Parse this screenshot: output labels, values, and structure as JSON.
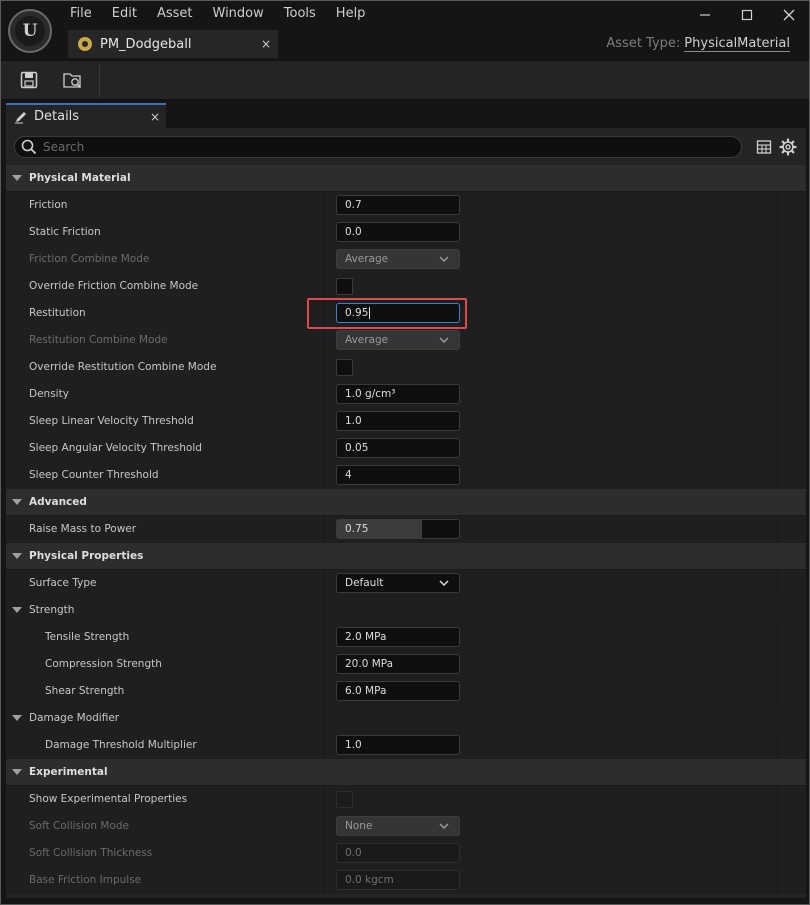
{
  "app": {
    "logo_text": "U"
  },
  "menu": [
    "File",
    "Edit",
    "Asset",
    "Window",
    "Tools",
    "Help"
  ],
  "document_tab": {
    "label": "PM_Dodgeball",
    "close": "×"
  },
  "asset_type": {
    "label": "Asset Type:",
    "value": "PhysicalMaterial"
  },
  "panel_tab": {
    "label": "Details",
    "close": "×"
  },
  "search": {
    "placeholder": "Search"
  },
  "categories": {
    "physical_material": "Physical Material",
    "advanced": "Advanced",
    "physical_properties": "Physical Properties",
    "experimental": "Experimental"
  },
  "subcategories": {
    "strength": "Strength",
    "damage_modifier": "Damage Modifier"
  },
  "props": {
    "friction": {
      "label": "Friction",
      "value": "0.7"
    },
    "static_friction": {
      "label": "Static Friction",
      "value": "0.0"
    },
    "friction_combine_mode": {
      "label": "Friction Combine Mode",
      "value": "Average"
    },
    "override_friction_combine_mode": {
      "label": "Override Friction Combine Mode",
      "checked": false
    },
    "restitution": {
      "label": "Restitution",
      "value": "0.95"
    },
    "restitution_combine_mode": {
      "label": "Restitution Combine Mode",
      "value": "Average"
    },
    "override_restitution_combine_mode": {
      "label": "Override Restitution Combine Mode",
      "checked": false
    },
    "density": {
      "label": "Density",
      "value": "1.0 g/cm³"
    },
    "sleep_linear_velocity_threshold": {
      "label": "Sleep Linear Velocity Threshold",
      "value": "1.0"
    },
    "sleep_angular_velocity_threshold": {
      "label": "Sleep Angular Velocity Threshold",
      "value": "0.05"
    },
    "sleep_counter_threshold": {
      "label": "Sleep Counter Threshold",
      "value": "4"
    },
    "raise_mass_to_power": {
      "label": "Raise Mass to Power",
      "value": "0.75",
      "fill_fraction": 0.7
    },
    "surface_type": {
      "label": "Surface Type",
      "value": "Default"
    },
    "tensile_strength": {
      "label": "Tensile Strength",
      "value": "2.0 MPa"
    },
    "compression_strength": {
      "label": "Compression Strength",
      "value": "20.0 MPa"
    },
    "shear_strength": {
      "label": "Shear Strength",
      "value": "6.0 MPa"
    },
    "damage_threshold_multiplier": {
      "label": "Damage Threshold Multiplier",
      "value": "1.0"
    },
    "show_experimental_properties": {
      "label": "Show Experimental Properties",
      "checked": false
    },
    "soft_collision_mode": {
      "label": "Soft Collision Mode",
      "value": "None"
    },
    "soft_collision_thickness": {
      "label": "Soft Collision Thickness",
      "value": "0.0"
    },
    "base_friction_impulse": {
      "label": "Base Friction Impulse",
      "value": "0.0 kgcm"
    }
  },
  "colors": {
    "accent": "#3d7fd1",
    "highlight": "#e14a4a",
    "panel": "#242424"
  },
  "icons": [
    "unreal-logo-icon",
    "physical-material-icon",
    "save-icon",
    "browse-icon",
    "details-pencil-icon",
    "search-icon",
    "table-icon",
    "gear-icon",
    "minimize-icon",
    "maximize-icon",
    "close-icon"
  ]
}
